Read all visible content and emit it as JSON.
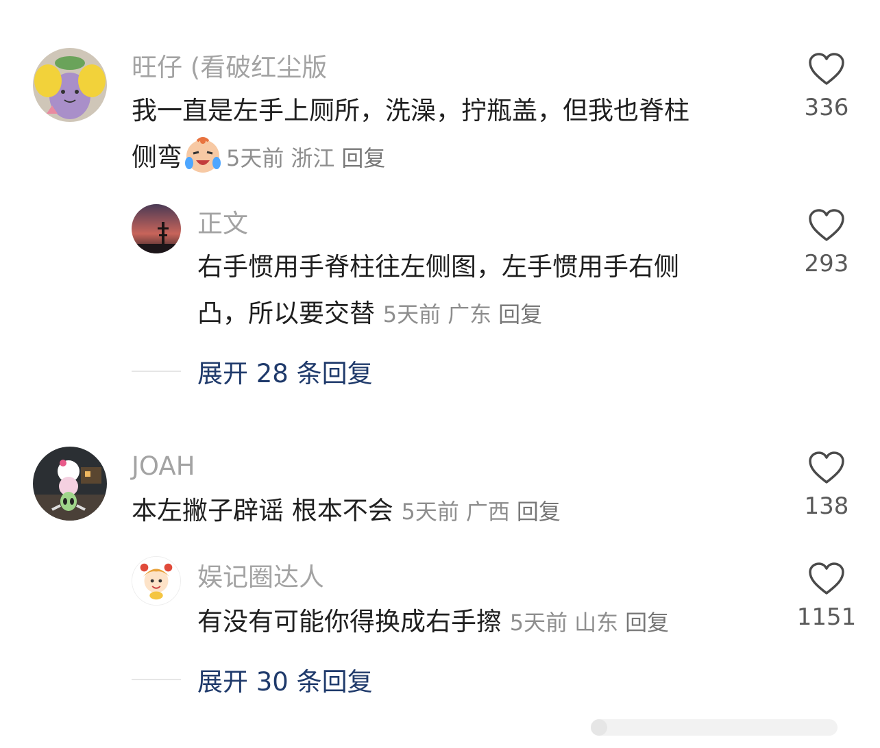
{
  "comments": [
    {
      "username": "旺仔 (看破红尘版",
      "text": "我一直是左手上厕所，洗澡，拧瓶盖，但我也脊柱侧弯",
      "line1": "我一直是左手上厕所，洗澡，拧瓶盖，但我也脊柱",
      "line2": "侧弯",
      "emoji": "crying-laughing-emoji",
      "time": "5天前",
      "location": "浙江",
      "reply_label": "回复",
      "likes": "336",
      "replies": [
        {
          "username": "正文",
          "line1": "右手惯用手脊柱往左侧图，左手惯用手右侧",
          "line2": "凸，所以要交替",
          "time": "5天前",
          "location": "广东",
          "reply_label": "回复",
          "likes": "293"
        }
      ],
      "expand_label": "展开 28 条回复"
    },
    {
      "username": "JOAH",
      "text": "本左撇子辟谣 根本不会",
      "time": "5天前",
      "location": "广西",
      "reply_label": "回复",
      "likes": "138",
      "replies": [
        {
          "username": "娱记圈达人",
          "text": "有没有可能你得换成右手擦",
          "time": "5天前",
          "location": "山东",
          "reply_label": "回复",
          "likes": "1151"
        }
      ],
      "expand_label": "展开 30 条回复"
    }
  ],
  "icons": {
    "like": "heart-outline-icon"
  },
  "colors": {
    "username": "#a3a3a3",
    "body": "#1f1f1f",
    "meta": "#8e8e8e",
    "expand": "#1f3a6b"
  }
}
